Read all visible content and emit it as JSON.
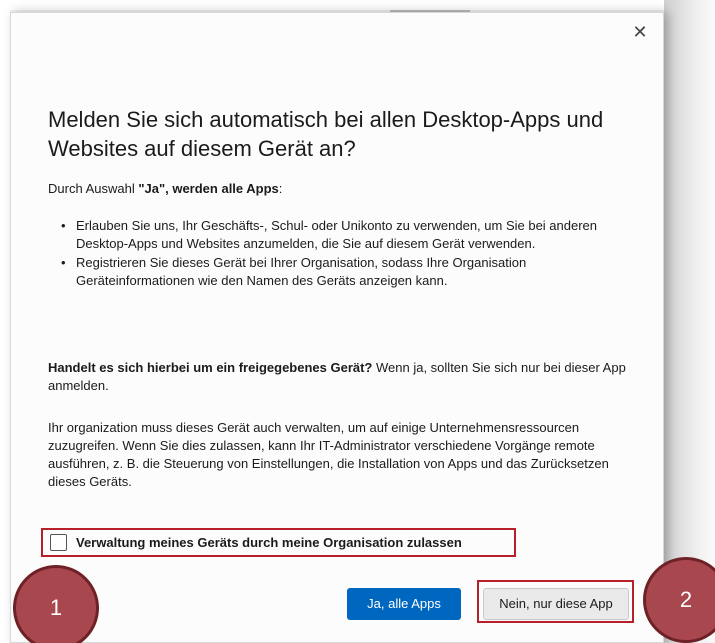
{
  "dialog": {
    "close_glyph": "✕",
    "title": "Melden Sie sich automatisch bei allen Desktop-Apps und Websites auf diesem Gerät an?",
    "intro_prefix": "Durch Auswahl ",
    "intro_bold": "\"Ja\", werden alle Apps",
    "intro_suffix": ":",
    "bullets": [
      "Erlauben Sie uns, Ihr Geschäfts-, Schul- oder Unikonto zu verwenden, um Sie bei anderen Desktop-Apps und Websites anzumelden, die Sie auf diesem Gerät verwenden.",
      "Registrieren Sie dieses Gerät bei Ihrer Organisation, sodass Ihre Organisation Geräteinformationen wie den Namen des Geräts anzeigen kann."
    ],
    "shared_bold": "Handelt es sich hierbei um ein freigegebenes Gerät?",
    "shared_rest": " Wenn ja, sollten Sie sich nur bei dieser App anmelden.",
    "manage_text": "Ihr organization muss dieses Gerät auch verwalten, um auf einige Unternehmensressourcen zuzugreifen. Wenn Sie dies zulassen, kann Ihr IT-Administrator verschiedene Vorgänge remote ausführen, z. B. die Steuerung von Einstellungen, die Installation von Apps und das Zurücksetzen dieses Geräts.",
    "checkbox_label": "Verwaltung meines Geräts durch meine Organisation zulassen",
    "checkbox_checked": false,
    "yes_button": "Ja, alle Apps",
    "no_button": "Nein, nur diese App"
  },
  "markers": {
    "one": "1",
    "two": "2"
  },
  "colors": {
    "primary_button": "#0067c0",
    "highlight_border": "#b5202a",
    "marker_fill": "#a8474d"
  }
}
